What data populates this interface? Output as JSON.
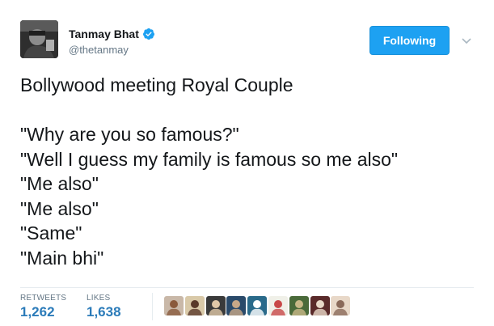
{
  "user": {
    "name": "Tanmay Bhat",
    "handle": "@thetanmay",
    "verified_icon": "verified-badge-icon"
  },
  "follow_button": {
    "label": "Following"
  },
  "menu_icon": "chevron-down-icon",
  "tweet": {
    "lines": [
      "Bollywood meeting Royal Couple",
      "",
      "\"Why are you so famous?\"",
      "\"Well I guess my family is famous so me also\"",
      "\"Me also\"",
      "\"Me also\"",
      "\"Same\"",
      "\"Main bhi\""
    ]
  },
  "stats": {
    "retweets_label": "RETWEETS",
    "retweets_value": "1,262",
    "likes_label": "LIKES",
    "likes_value": "1,638"
  },
  "colors": {
    "accent": "#1da1f2",
    "stat_value": "#2b7bb9",
    "muted": "#657786",
    "text": "#14171a"
  },
  "liker_avatars": [
    {
      "bg": "#c9b8a8",
      "fg": "#8a5a3c"
    },
    {
      "bg": "#d9c9a8",
      "fg": "#5a3a2a"
    },
    {
      "bg": "#3a3a3a",
      "fg": "#e0c8a8"
    },
    {
      "bg": "#2a4a6a",
      "fg": "#c8a888"
    },
    {
      "bg": "#2a6a8a",
      "fg": "#ffffff"
    },
    {
      "bg": "#f0f0e8",
      "fg": "#c84848"
    },
    {
      "bg": "#4a6a3a",
      "fg": "#c8b888"
    },
    {
      "bg": "#5a2a2a",
      "fg": "#e8d8c8"
    },
    {
      "bg": "#e8d8c8",
      "fg": "#8a6a5a"
    }
  ]
}
